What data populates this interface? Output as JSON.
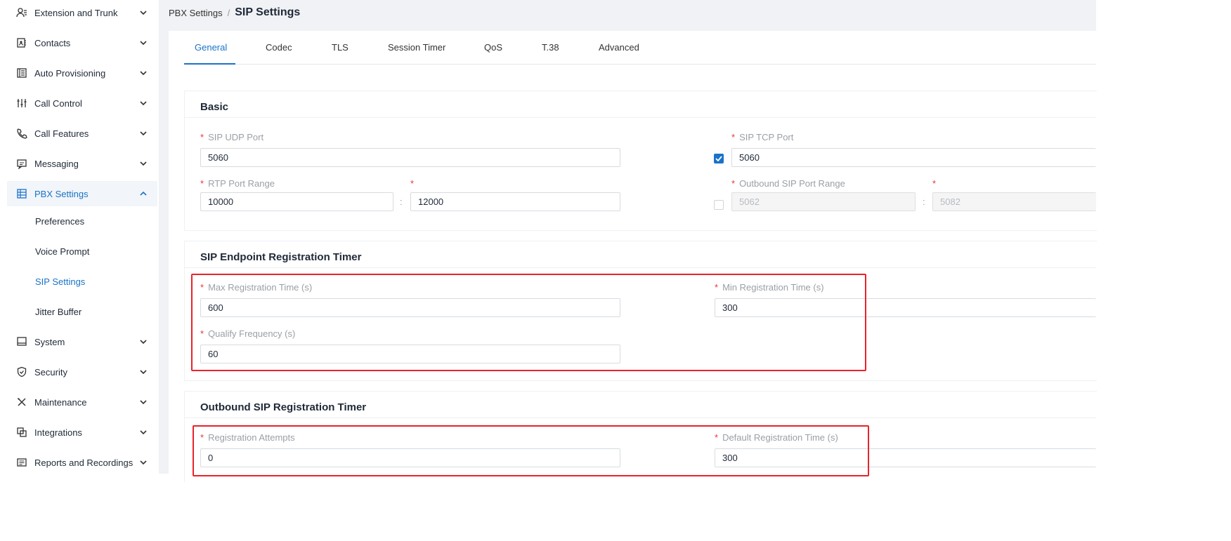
{
  "sidebar": {
    "items": [
      {
        "label": "Extension and Trunk",
        "icon": "user-list-icon"
      },
      {
        "label": "Contacts",
        "icon": "contacts-book-icon"
      },
      {
        "label": "Auto Provisioning",
        "icon": "provisioning-icon"
      },
      {
        "label": "Call Control",
        "icon": "sliders-icon"
      },
      {
        "label": "Call Features",
        "icon": "phone-icon"
      },
      {
        "label": "Messaging",
        "icon": "message-icon"
      },
      {
        "label": "PBX Settings",
        "icon": "settings-list-icon"
      },
      {
        "label": "System",
        "icon": "monitor-icon"
      },
      {
        "label": "Security",
        "icon": "shield-icon"
      },
      {
        "label": "Maintenance",
        "icon": "tools-icon"
      },
      {
        "label": "Integrations",
        "icon": "integrations-icon"
      },
      {
        "label": "Reports and Recordings",
        "icon": "report-icon"
      }
    ],
    "pbx_sub_items": [
      "Preferences",
      "Voice Prompt",
      "SIP Settings",
      "Jitter Buffer"
    ],
    "active_item": "PBX Settings",
    "active_sub_item": "SIP Settings"
  },
  "breadcrumb": {
    "parent": "PBX Settings",
    "separator": "/",
    "current": "SIP Settings"
  },
  "tabs": [
    "General",
    "Codec",
    "TLS",
    "Session Timer",
    "QoS",
    "T.38",
    "Advanced"
  ],
  "active_tab": "General",
  "basic": {
    "title": "Basic",
    "sip_udp_port": {
      "label": "SIP UDP Port",
      "value": "5060"
    },
    "sip_tcp_port": {
      "label": "SIP TCP Port",
      "value": "5060",
      "enabled": true
    },
    "rtp_port_range": {
      "label": "RTP Port Range",
      "start": "10000",
      "end": "12000"
    },
    "outbound_sip_port_range": {
      "label": "Outbound SIP Port Range",
      "start": "5062",
      "end": "5082",
      "enabled": false
    },
    "range_separator": ":"
  },
  "endpoint_timer": {
    "title": "SIP Endpoint Registration Timer",
    "max_registration_time": {
      "label": "Max Registration Time (s)",
      "value": "600"
    },
    "min_registration_time": {
      "label": "Min Registration Time (s)",
      "value": "300"
    },
    "qualify_frequency": {
      "label": "Qualify Frequency (s)",
      "value": "60"
    }
  },
  "outbound_timer": {
    "title": "Outbound SIP Registration Timer",
    "registration_attempts": {
      "label": "Registration Attempts",
      "value": "0"
    },
    "default_registration_time": {
      "label": "Default Registration Time (s)",
      "value": "300"
    }
  },
  "required_mark": "*",
  "colors": {
    "accent": "#1a73c8",
    "required": "#e53935",
    "highlight": "#e8232a"
  }
}
